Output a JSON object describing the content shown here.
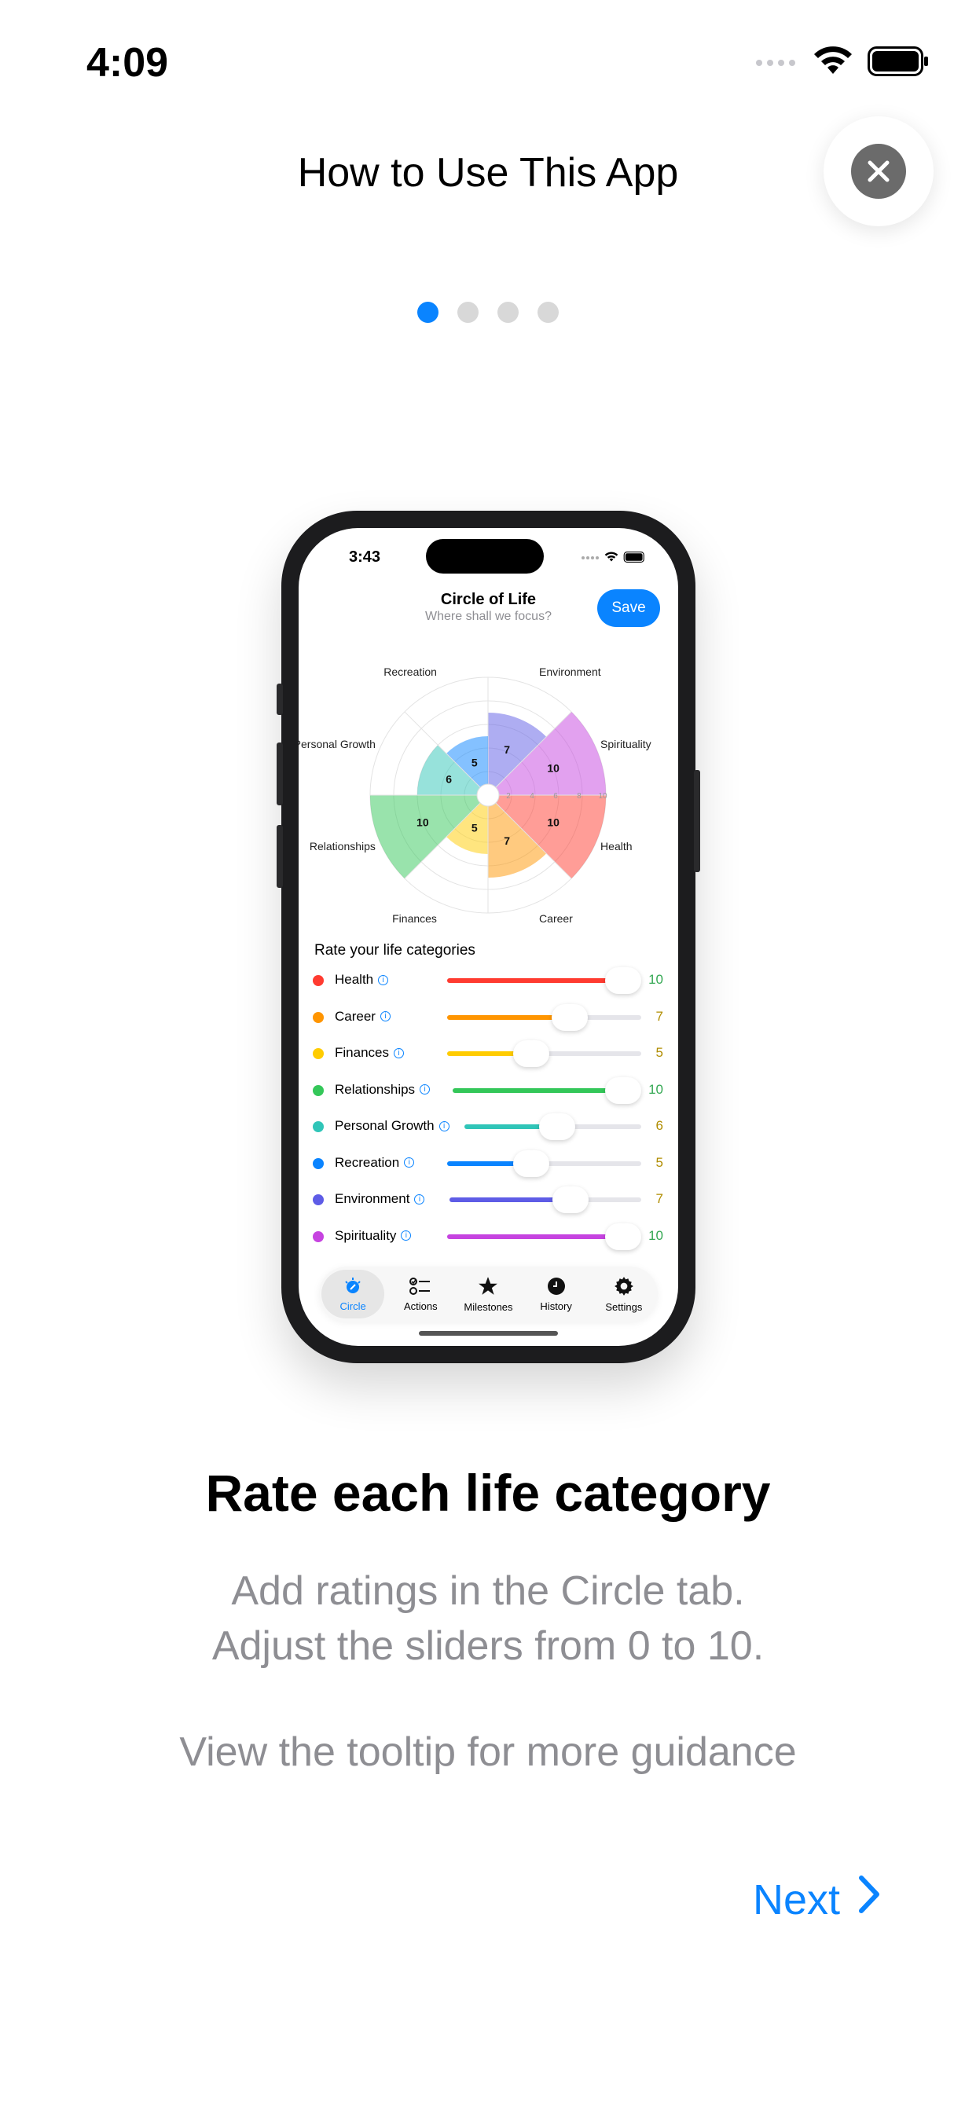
{
  "status_bar": {
    "time": "4:09"
  },
  "header": {
    "title": "How to Use This App"
  },
  "pager": {
    "count": 4,
    "active_index": 0
  },
  "mockup": {
    "status_time": "3:43",
    "title": "Circle of Life",
    "subtitle": "Where shall we focus?",
    "save_label": "Save",
    "rate_title": "Rate your life categories",
    "scale_ticks": [
      "2",
      "4",
      "6",
      "8",
      "10"
    ],
    "categories": [
      {
        "name": "Health",
        "value": 10,
        "color": "#ff3b30"
      },
      {
        "name": "Career",
        "value": 7,
        "color": "#ff9500"
      },
      {
        "name": "Finances",
        "value": 5,
        "color": "#ffcc00"
      },
      {
        "name": "Relationships",
        "value": 10,
        "color": "#34c759"
      },
      {
        "name": "Personal Growth",
        "value": 6,
        "color": "#30c5b8"
      },
      {
        "name": "Recreation",
        "value": 5,
        "color": "#0a84ff"
      },
      {
        "name": "Environment",
        "value": 7,
        "color": "#5e5ce6"
      },
      {
        "name": "Spirituality",
        "value": 10,
        "color": "#c643e0"
      }
    ],
    "value_colors": {
      "high": "#34a853",
      "mid": "#b08d00"
    },
    "tabs": [
      {
        "label": "Circle",
        "icon": "circle-tab-icon",
        "active": true
      },
      {
        "label": "Actions",
        "icon": "checklist-icon",
        "active": false
      },
      {
        "label": "Milestones",
        "icon": "star-icon",
        "active": false
      },
      {
        "label": "History",
        "icon": "clock-icon",
        "active": false
      },
      {
        "label": "Settings",
        "icon": "gear-icon",
        "active": false
      }
    ]
  },
  "content": {
    "headline": "Rate each life category",
    "body_line1": "Add ratings in the Circle tab.",
    "body_line2": "Adjust the sliders from 0 to 10.",
    "body_tip": "View the tooltip for more guidance"
  },
  "footer": {
    "next_label": "Next"
  },
  "accent_color": "#0a84ff"
}
